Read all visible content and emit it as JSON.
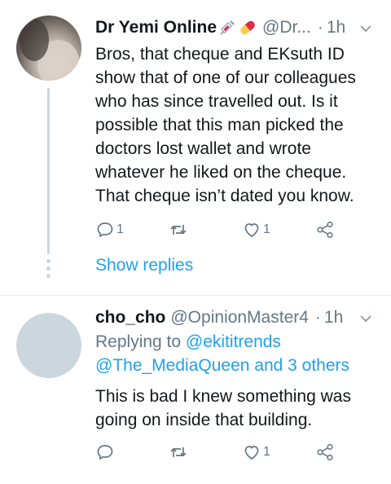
{
  "tweet1": {
    "name": "Dr Yemi Online",
    "handle": "@Dr...",
    "separator": "·",
    "time": "1h",
    "text": "Bros, that cheque and EKsuth ID show that of one of our colleagues who has since travelled out. Is it possible that this man picked the doctors lost wallet and wrote whatever he liked on the cheque. That cheque isn’t dated you know.",
    "reply_count": "1",
    "like_count": "1",
    "show_replies": "Show replies"
  },
  "tweet2": {
    "name": "cho_cho",
    "handle": "@OpinionMaster4",
    "separator": "·",
    "time": "1h",
    "replying_to": "Replying to",
    "reply_user": "@ekititrends",
    "reply_others": "@The_MediaQueen and 3 others",
    "text": "This is bad I knew something was going on inside that building.",
    "like_count": "1"
  },
  "colors": {
    "accent": "#1da1f2",
    "secondary_text": "#657786",
    "avatar_placeholder": "#ccd6dd"
  }
}
